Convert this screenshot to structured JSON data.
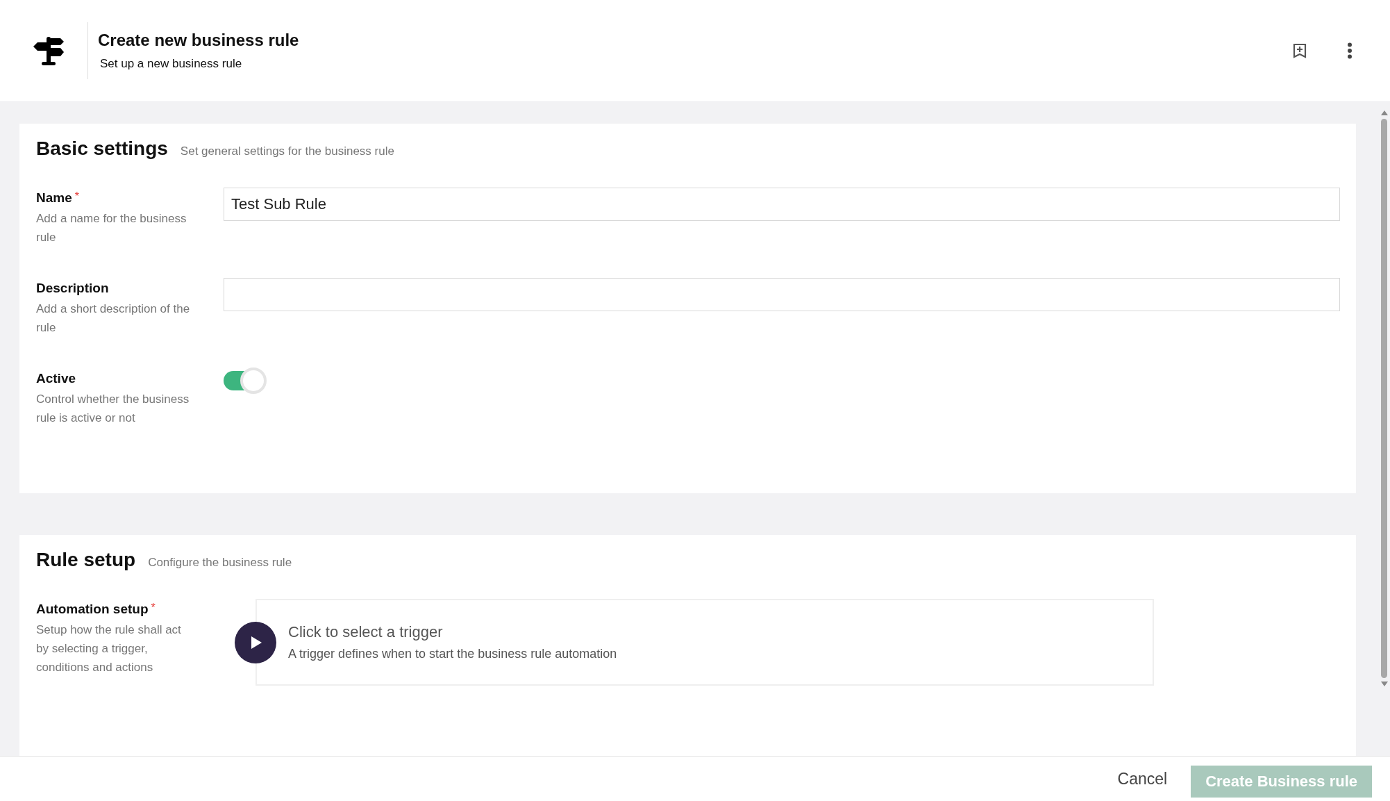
{
  "header": {
    "title": "Create new business rule",
    "subtitle": "Set up a new business rule"
  },
  "sections": [
    {
      "title": "Basic settings",
      "subtitle": "Set general settings for the business rule",
      "fields": [
        {
          "kind": "text",
          "label": "Name",
          "required_mark": "*",
          "help": "Add a name for the business rule",
          "value": "Test Sub Rule"
        },
        {
          "kind": "text",
          "label": "Description",
          "help": "Add a short description of the rule"
        },
        {
          "kind": "toggle",
          "label": "Active",
          "help": "Control whether the business rule is active or not",
          "on": true
        }
      ]
    },
    {
      "title": "Rule setup",
      "subtitle": "Configure the business rule",
      "fields": [
        {
          "kind": "trigger",
          "label": "Automation setup",
          "required_mark": "*",
          "help": "Setup how the rule shall act by selecting a trigger, conditions and actions",
          "trigger_title": "Click to select a trigger",
          "trigger_help": "A trigger defines when to start the business rule automation"
        }
      ]
    }
  ],
  "footer": {
    "cancel": "Cancel",
    "submit": {
      "label": "Create Business rule",
      "disabled": true
    }
  }
}
